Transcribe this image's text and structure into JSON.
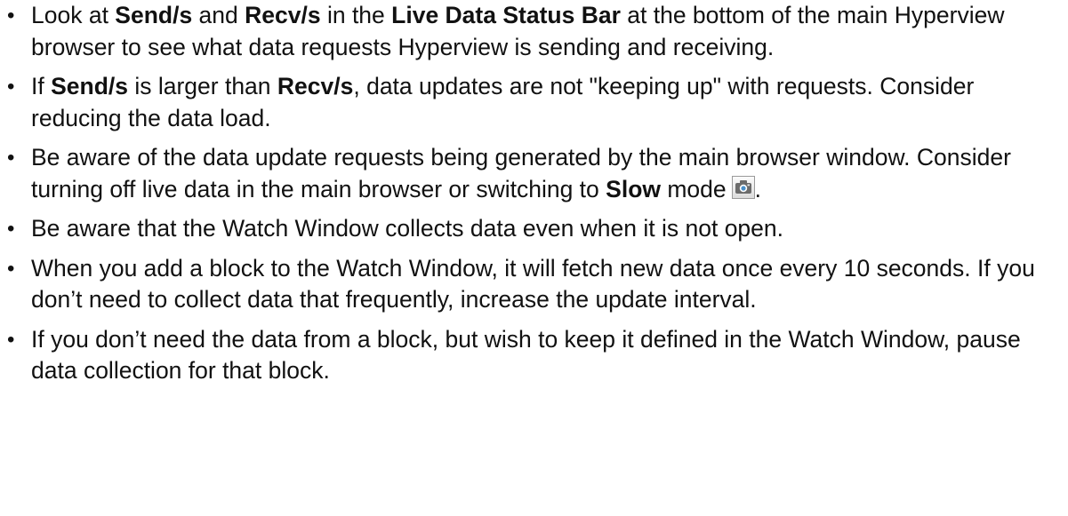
{
  "items": [
    {
      "t1": "Look at ",
      "b1": "Send/s",
      "t2": " and ",
      "b2": "Recv/s",
      "t3": " in the ",
      "b3": "Live Data Status Bar",
      "t4": " at the bottom of the main Hyperview browser to see what data requests Hyperview is sending and receiving."
    },
    {
      "t1": "If ",
      "b1": "Send/s",
      "t2": " is larger than ",
      "b2": "Recv/s",
      "t3": ", data updates are not \"keeping up\" with requests. Consider reducing the data load."
    },
    {
      "t1": "Be aware of the data update requests being generated by the main browser window. Consider turning off live data in the main browser or switching to ",
      "b1": "Slow",
      "t2": " mode",
      "t3": ".",
      "icon": "camera-icon"
    },
    {
      "t1": "Be aware that the Watch Window collects data even when it is not open."
    },
    {
      "t1": "When you add a block to the Watch Window, it will fetch new data once every 10 seconds. If you don’t need to collect data that frequently, increase the update interval."
    },
    {
      "t1": "If you don’t need the data from a block, but wish to keep it defined in the Watch Window, pause data collection for that block."
    }
  ]
}
